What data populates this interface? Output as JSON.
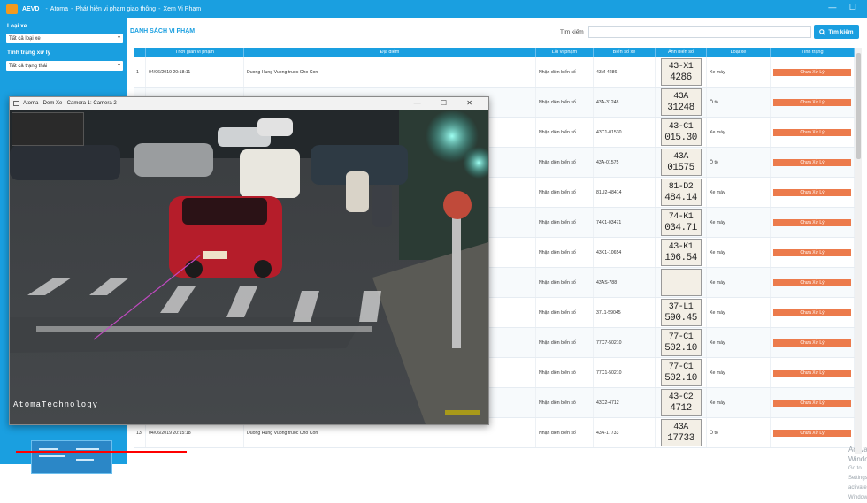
{
  "window": {
    "app": "AEVD",
    "app_name": "Atoma",
    "title": "Phát hiện vi phạm giao thông",
    "page": "Xem Vi Phạm",
    "controls": "— ☐"
  },
  "sidebar": {
    "vehicle_type_label": "Loại xe",
    "vehicle_type_value": "Tất cả loại xe",
    "status_label": "Tình trạng xử lý",
    "status_value": "Tất cả trạng thái"
  },
  "main": {
    "list_title": "DANH SÁCH VI PHẠM",
    "search_label": "Tìm kiếm",
    "search_placeholder": "",
    "search_button": "Tìm kiếm"
  },
  "table": {
    "columns": [
      "",
      "Thời gian vi phạm",
      "Địa điểm",
      "Lỗi vi phạm",
      "Biển số xe",
      "Ảnh biển số",
      "Loại xe",
      "Tình trạng"
    ],
    "rows": [
      {
        "idx": "1",
        "time": "04/06/2019 20:18:11",
        "place": "Duong Hung Vuong truoc Cho Con",
        "error": "Nhận diện biển số",
        "plate": "43M-4286",
        "img1": "43-X1",
        "img2": "4286",
        "vtype": "Xe máy",
        "status": "Chưa Xử Lý"
      },
      {
        "idx": "",
        "time": "",
        "place": "",
        "error": "Nhận diện biển số",
        "plate": "43A-31248",
        "img1": "43A",
        "img2": "31248",
        "vtype": "Ô tô",
        "status": "Chưa Xử Lý"
      },
      {
        "idx": "",
        "time": "",
        "place": "",
        "error": "Nhận diện biển số",
        "plate": "43C1-01530",
        "img1": "43-C1",
        "img2": "015.30",
        "vtype": "Xe máy",
        "status": "Chưa Xử Lý"
      },
      {
        "idx": "",
        "time": "",
        "place": "",
        "error": "Nhận diện biển số",
        "plate": "43A-01575",
        "img1": "43A",
        "img2": "01575",
        "vtype": "Ô tô",
        "status": "Chưa Xử Lý"
      },
      {
        "idx": "",
        "time": "",
        "place": "",
        "error": "Nhận diện biển số",
        "plate": "81U2-48414",
        "img1": "81-D2",
        "img2": "484.14",
        "vtype": "Xe máy",
        "status": "Chưa Xử Lý"
      },
      {
        "idx": "",
        "time": "",
        "place": "",
        "error": "Nhận diện biển số",
        "plate": "74K1-03471",
        "img1": "74-K1",
        "img2": "034.71",
        "vtype": "Xe máy",
        "status": "Chưa Xử Lý"
      },
      {
        "idx": "",
        "time": "",
        "place": "",
        "error": "Nhận diện biển số",
        "plate": "43K1-10654",
        "img1": "43-K1",
        "img2": "106.54",
        "vtype": "Xe máy",
        "status": "Chưa Xử Lý"
      },
      {
        "idx": "",
        "time": "",
        "place": "",
        "error": "Nhận diện biển số",
        "plate": "43AS-788",
        "img1": "",
        "img2": "",
        "vtype": "Xe máy",
        "status": "Chưa Xử Lý"
      },
      {
        "idx": "",
        "time": "",
        "place": "",
        "error": "Nhận diện biển số",
        "plate": "37L1-59045",
        "img1": "37-L1",
        "img2": "590.45",
        "vtype": "Xe máy",
        "status": "Chưa Xử Lý"
      },
      {
        "idx": "",
        "time": "",
        "place": "",
        "error": "Nhận diện biển số",
        "plate": "77C7-50210",
        "img1": "77-C1",
        "img2": "502.10",
        "vtype": "Xe máy",
        "status": "Chưa Xử Lý"
      },
      {
        "idx": "",
        "time": "",
        "place": "",
        "error": "Nhận diện biển số",
        "plate": "77C1-50210",
        "img1": "77-C1",
        "img2": "502.10",
        "vtype": "Xe máy",
        "status": "Chưa Xử Lý"
      },
      {
        "idx": "",
        "time": "",
        "place": "",
        "error": "Nhận diện biển số",
        "plate": "43C2-4712",
        "img1": "43-C2",
        "img2": "4712",
        "vtype": "Xe máy",
        "status": "Chưa Xử Lý"
      },
      {
        "idx": "13",
        "time": "04/06/2019 20:15:18",
        "place": "Duong Hung Vuong truoc Cho Con",
        "error": "Nhận diện biển số",
        "plate": "43A-17733",
        "img1": "43A",
        "img2": "17733",
        "vtype": "Ô tô",
        "status": "Chưa Xử Lý"
      }
    ]
  },
  "camera": {
    "title": "Atoma - Dem Xe - Camera 1: Camera 2",
    "controls": "— ☐ ✕",
    "brand": "AtomaTechnology"
  },
  "watermark": {
    "line1": "Activate Windows",
    "line2": "Go to Settings to activate Windows."
  },
  "video": {
    "progress_percent": 42
  },
  "colors": {
    "accent": "#1a9fe0",
    "status": "#ec7b4c"
  }
}
